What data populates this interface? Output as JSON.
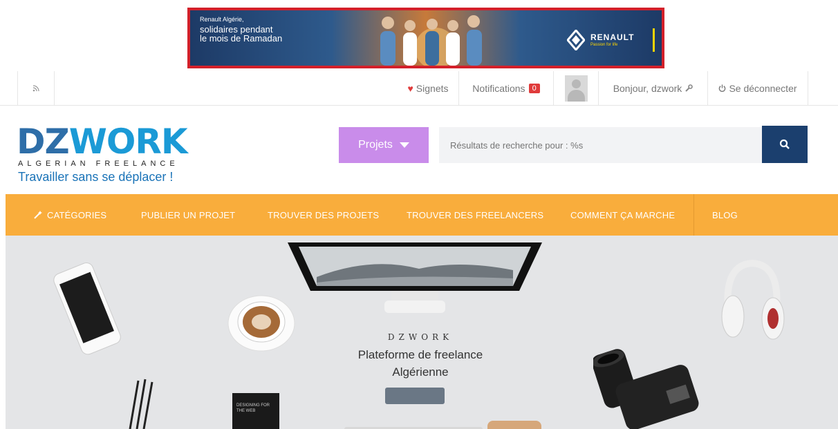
{
  "ad": {
    "small_text": "Renault Algérie,",
    "text_line1": "solidaires pendant",
    "text_line2": "le mois de Ramadan",
    "brand": "RENAULT",
    "brand_tagline": "Passion for life",
    "border_color": "#d3202a"
  },
  "topbar": {
    "rss_icon": "rss-icon",
    "signets": "Signets",
    "notifications": "Notifications",
    "notifications_count": "0",
    "greeting": "Bonjour, dzwork",
    "logout": "Se déconnecter"
  },
  "header": {
    "logo_dz": "DZ",
    "logo_work": "WORK",
    "logo_sub": "ALGERIAN FREELANCE",
    "tagline": "Travailler sans se déplacer !",
    "projects_dropdown": "Projets",
    "search_placeholder": "Résultats de recherche pour : %s"
  },
  "nav": {
    "items": [
      {
        "label": "CATÉGORIES"
      },
      {
        "label": "PUBLIER UN PROJET"
      },
      {
        "label": "TROUVER DES PROJETS"
      },
      {
        "label": "TROUVER DES FREELANCERS"
      },
      {
        "label": "COMMENT ÇA MARCHE"
      },
      {
        "label": "BLOG"
      }
    ],
    "color": "#f9ad3c"
  },
  "hero": {
    "brand_small": "DZWORK",
    "title_line1": "Plateforme de freelance",
    "title_line2": "Algérienne",
    "notebook_text": "DESIGNING FOR THE WEB"
  },
  "colors": {
    "accent_purple": "#c98cea",
    "search_button": "#1b3f6e",
    "logo_blue": "#1b9ad6"
  }
}
